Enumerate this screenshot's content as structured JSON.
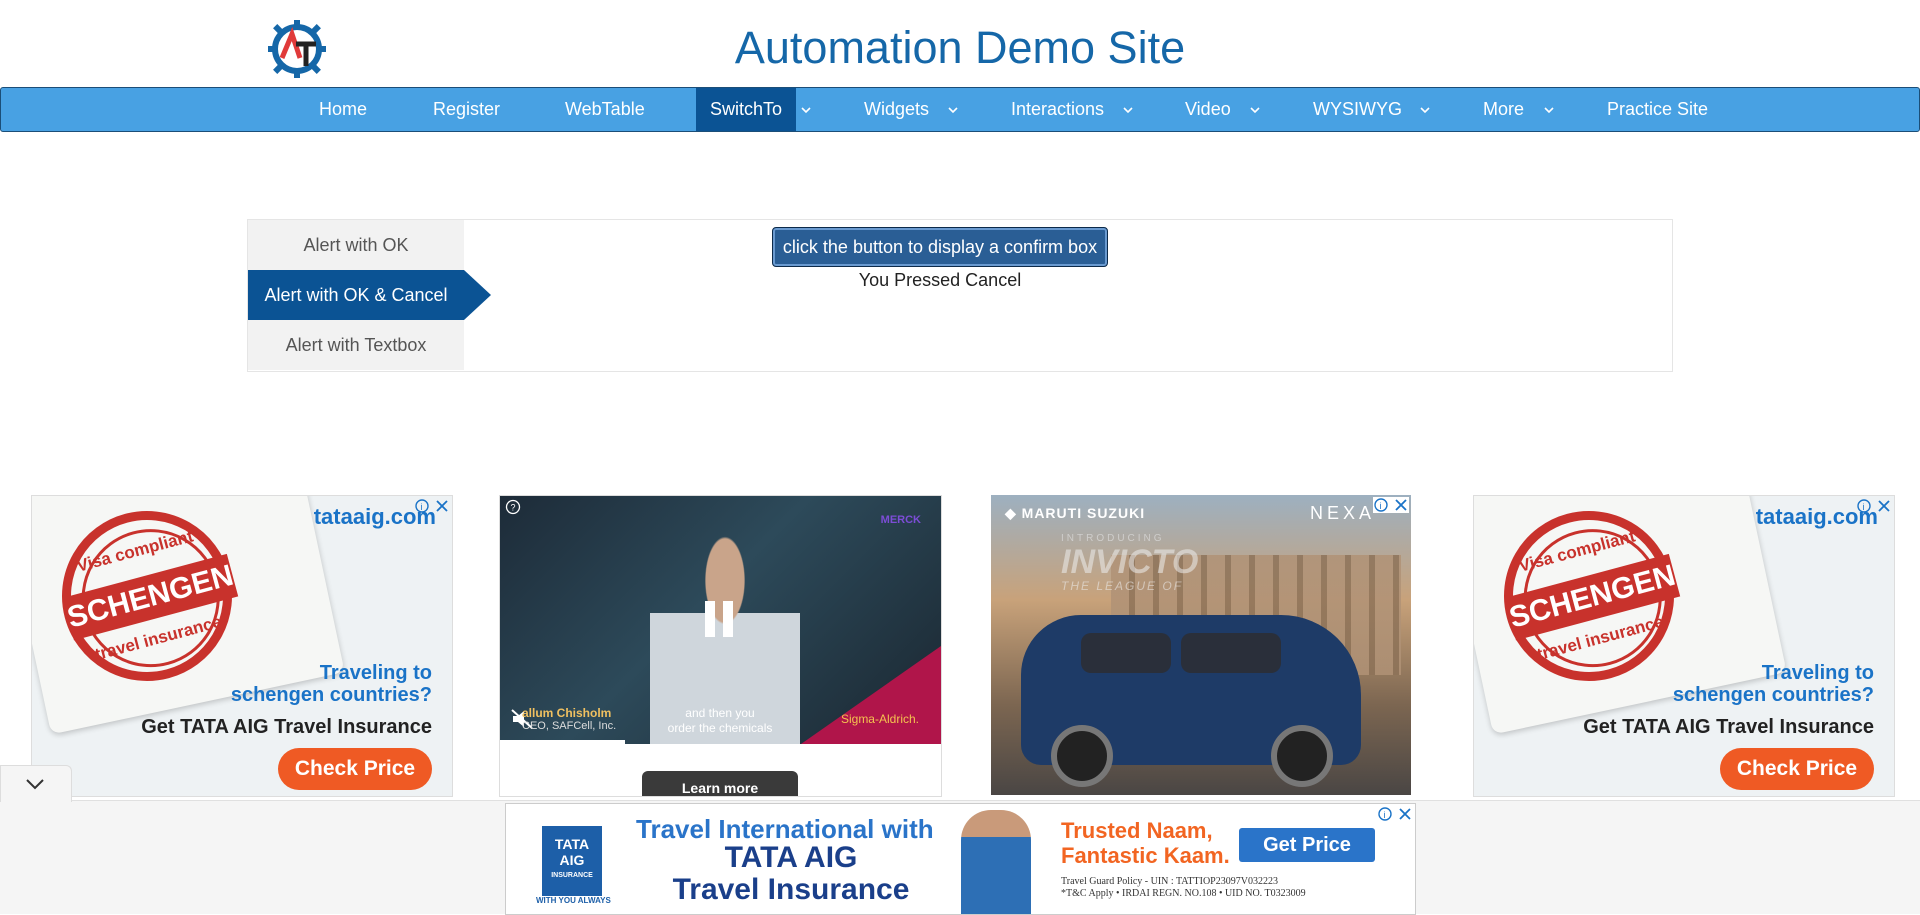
{
  "site": {
    "title": "Automation Demo Site"
  },
  "nav": {
    "items": [
      {
        "label": "Home"
      },
      {
        "label": "Register"
      },
      {
        "label": "WebTable"
      },
      {
        "label": "SwitchTo",
        "active": true
      },
      {
        "label": "Widgets"
      },
      {
        "label": "Interactions"
      },
      {
        "label": "Video"
      },
      {
        "label": "WYSIWYG"
      },
      {
        "label": "More"
      },
      {
        "label": "Practice Site"
      }
    ]
  },
  "alerts": {
    "tabs": [
      {
        "label": "Alert with OK"
      },
      {
        "label": "Alert with OK & Cancel",
        "active": true
      },
      {
        "label": "Alert with Textbox"
      }
    ],
    "confirm_button": "click the button to display a confirm box",
    "result": "You Pressed Cancel"
  },
  "ads": {
    "schengen": {
      "brand": "tataaig.com",
      "stamp_top": "Visa compliant",
      "stamp_main": "SCHENGEN",
      "stamp_bottom": "travel insurance",
      "headline_1": "Traveling to",
      "headline_2": "schengen countries?",
      "subline": "Get TATA AIG Travel Insurance",
      "cta": "Check Price"
    },
    "video": {
      "brand": "MERCK",
      "person_name": "allum Chisholm",
      "person_role": "CEO, SAFCell, Inc.",
      "caption_1": "and then you",
      "caption_2": "order the chemicals",
      "sponsor": "Sigma-Aldrich.",
      "cta": "Learn more"
    },
    "suzuki": {
      "brand": "MARUTI SUZUKI",
      "nexa": "NEXA",
      "tagline_1": "INTRODUCING",
      "tagline_2": "INVICTO",
      "tagline_3": "THE LEAGUE OF"
    },
    "bottom": {
      "logo_1": "TATA",
      "logo_2": "AIG",
      "logo_3": "INSURANCE",
      "logo_tagline": "WITH YOU ALWAYS",
      "line_1": "Travel International with",
      "line_2": "TATA AIG",
      "line_3": "Travel Insurance",
      "trusted_1": "Trusted Naam,",
      "trusted_2": "Fantastic Kaam.",
      "cta": "Get Price",
      "fine_1": "Travel Guard Policy - UIN : TATTIOP23097V032223",
      "fine_2": "*T&C Apply  •  IRDAI REGN. NO.108  •  UID NO. T0323009"
    }
  },
  "colors": {
    "nav_bg": "#48a1e3",
    "nav_active": "#0b5394",
    "title": "#1567a8",
    "cta_orange": "#ef5a24"
  }
}
